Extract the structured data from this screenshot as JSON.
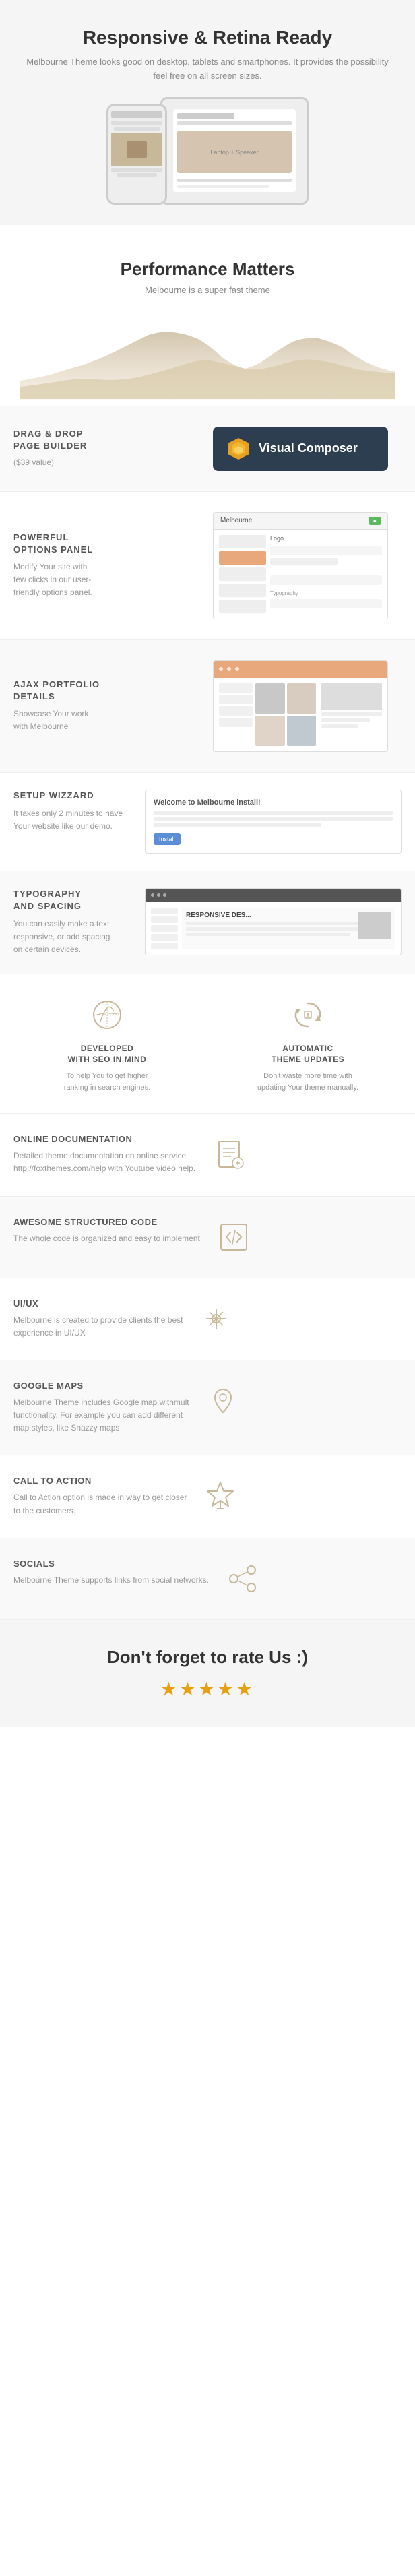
{
  "section1": {
    "title": "Responsive  & Retina Ready",
    "description": "Melbourne Theme looks good on desktop, tablets and smartphones.\nIt provides the possibility feel free on all screen sizes."
  },
  "section2": {
    "title": "Performance Matters",
    "subtitle": "Melbourne is a super fast theme"
  },
  "section3": {
    "title": "DRAG & DROP\nPAGE BUILDER",
    "badge": "($39 value)",
    "vc_label": "Visual Composer"
  },
  "section4": {
    "title": "POWERFUL\nOPTIONS PANEL",
    "description": "Modify Your site with\nfew clicks in our user-\nfriendly options panel."
  },
  "section5": {
    "title": "AJAX PORTFOLIO\nDETAILS",
    "description": "Showcase Your work\nwith Melbourne"
  },
  "section6": {
    "title": "SETUP WIZZARD",
    "description": "It takes only 2 minutes to have\nYour website like our demo.",
    "setup_title": "Welcome to Melbourne install!",
    "setup_btn": "Install"
  },
  "section7": {
    "title": "TYPOGRAPHY\nAND SPACING",
    "description": "You can easily make a text\nresponsive, or add spacing\non certain devices.",
    "mock_heading": "RESPONSIVE DES..."
  },
  "section8": {
    "title1": "DEVELOPED\nWITH SEO IN MIND",
    "desc1": "To help You to get higher\nranking in search engines.",
    "title2": "AUTOMATIC\nTHEME UPDATES",
    "desc2": "Don't waste more time with\nupdating Your theme manually."
  },
  "section9": {
    "title": "ONLINE DOCUMENTATION",
    "description": "Detailed theme documentation on online service\nhttp://foxthemes.com/help with Youtube video help."
  },
  "section10": {
    "title": "AWESOME STRUCTURED CODE",
    "description": "The whole code is organized and easy to implement"
  },
  "section11": {
    "title": "UI/UX",
    "description": "Melbourne is created to provide clients the best\nexperience in UI/UX"
  },
  "section12": {
    "title": "GOOGLE MAPS",
    "description": "Melbourne Theme includes Google map withmult\nfunctionality. For example you can add different\nmap styles, like Snazzy maps"
  },
  "section13": {
    "title": "CALL TO ACTION",
    "description": "Call to Action option is made in way to get closer\nto the customers."
  },
  "section14": {
    "title": "SOCIALS",
    "description": "Melbourne Theme supports links from social networks."
  },
  "footer": {
    "text": "Don't forget to rate Us :)",
    "stars": "★★★★★"
  }
}
